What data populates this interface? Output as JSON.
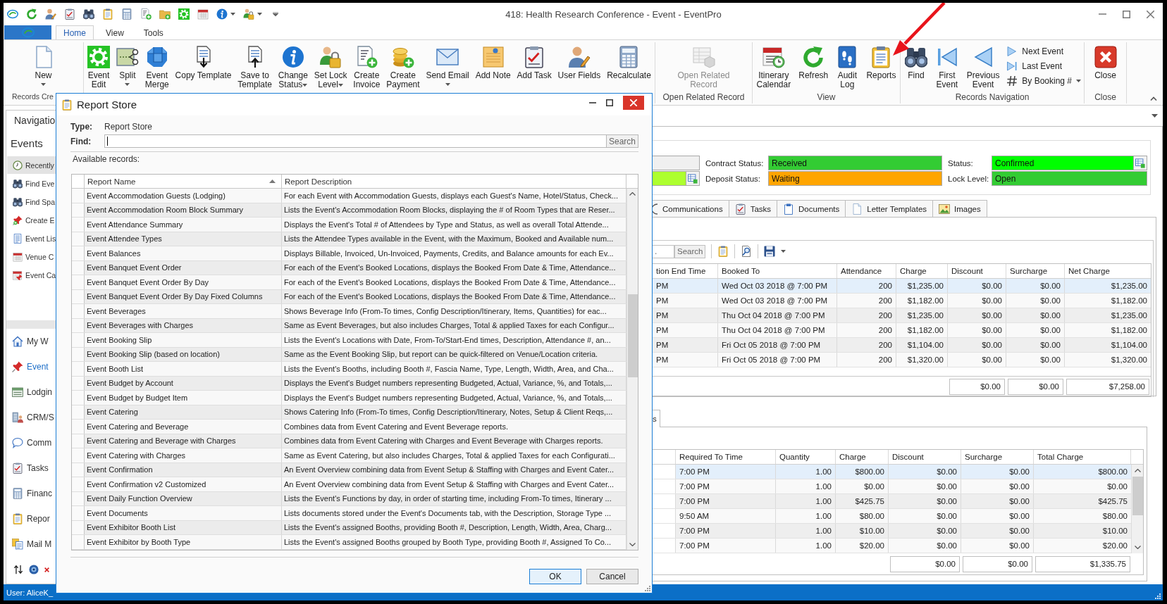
{
  "window": {
    "title": "418: Health Research Conference - Event - EventPro"
  },
  "ribbon": {
    "tabs": [
      {
        "label": "Home",
        "selected": true
      },
      {
        "label": "View",
        "selected": false
      },
      {
        "label": "Tools",
        "selected": false
      }
    ],
    "groups": [
      {
        "label": "Records Cre",
        "buttons": [
          {
            "label": "New",
            "kind": "large",
            "dropdown": true,
            "disabled": false
          }
        ]
      },
      {
        "buttons": [
          {
            "label": "Event\nEdit",
            "kind": "large",
            "dropdown": false,
            "disabled": false
          },
          {
            "label": "Split",
            "kind": "large",
            "dropdown": true,
            "disabled": false
          },
          {
            "label": "Event\nMerge",
            "kind": "large",
            "dropdown": false,
            "disabled": false
          },
          {
            "label": "Copy Template",
            "kind": "large",
            "dropdown": false,
            "disabled": false
          },
          {
            "label": "Save to\nTemplate",
            "kind": "large",
            "dropdown": false,
            "disabled": false
          },
          {
            "label": "Change\nStatus",
            "kind": "large",
            "dropdown": true,
            "disabled": false
          },
          {
            "label": "Set Lock\nLevel",
            "kind": "large",
            "dropdown": true,
            "disabled": false
          },
          {
            "label": "Create\nInvoice",
            "kind": "large",
            "dropdown": false,
            "disabled": false
          },
          {
            "label": "Create\nPayment",
            "kind": "large",
            "dropdown": false,
            "disabled": false
          },
          {
            "label": "Send Email",
            "kind": "large",
            "dropdown": true,
            "disabled": false
          },
          {
            "label": "Add Note",
            "kind": "large",
            "dropdown": false,
            "disabled": false
          },
          {
            "label": "Add Task",
            "kind": "large",
            "dropdown": false,
            "disabled": false
          },
          {
            "label": "User Fields",
            "kind": "large",
            "dropdown": false,
            "disabled": false
          },
          {
            "label": "Recalculate",
            "kind": "large",
            "dropdown": false,
            "disabled": false
          }
        ]
      },
      {
        "label": "Open Related Record",
        "buttons": [
          {
            "label": "Open Related\nRecord",
            "kind": "large",
            "dropdown": false,
            "disabled": true
          }
        ]
      },
      {
        "label": "View",
        "buttons": [
          {
            "label": "Itinerary\nCalendar",
            "kind": "large",
            "dropdown": false,
            "disabled": false
          },
          {
            "label": "Refresh",
            "kind": "large",
            "dropdown": false,
            "disabled": false
          },
          {
            "label": "Audit\nLog",
            "kind": "large",
            "dropdown": false,
            "disabled": false
          },
          {
            "label": "Reports",
            "kind": "large",
            "dropdown": false,
            "disabled": false
          }
        ]
      },
      {
        "label": "Records Navigation",
        "buttons": [
          {
            "label": "Find",
            "kind": "large",
            "dropdown": false,
            "disabled": false
          },
          {
            "label": "First\nEvent",
            "kind": "large",
            "dropdown": false,
            "disabled": false
          },
          {
            "label": "Previous\nEvent",
            "kind": "large",
            "dropdown": false,
            "disabled": false
          },
          {
            "label": "Next Event",
            "kind": "small",
            "dropdown": false,
            "disabled": false
          },
          {
            "label": "Last Event",
            "kind": "small",
            "dropdown": false,
            "disabled": false
          },
          {
            "label": "By Booking #",
            "kind": "small",
            "dropdown": true,
            "disabled": false
          }
        ]
      },
      {
        "label": "Close",
        "buttons": [
          {
            "label": "Close",
            "kind": "large",
            "dropdown": false,
            "disabled": false
          }
        ]
      }
    ]
  },
  "navigation": {
    "title": "Navigatio",
    "section": "Events",
    "items": [
      {
        "label": "Recently",
        "selected": true
      },
      {
        "label": "Find Eve",
        "selected": false
      },
      {
        "label": "Find Spa",
        "selected": false
      },
      {
        "label": "Create E",
        "selected": false
      },
      {
        "label": "Event Lis",
        "selected": false
      },
      {
        "label": "Venue C",
        "selected": false
      },
      {
        "label": "Event Ca",
        "selected": false
      }
    ],
    "modules": [
      {
        "label": "My W",
        "selected": false
      },
      {
        "label": "Event",
        "selected": true
      },
      {
        "label": "Lodgin",
        "selected": false
      },
      {
        "label": "CRM/S",
        "selected": false
      },
      {
        "label": "Comm",
        "selected": false
      },
      {
        "label": "Tasks",
        "selected": false
      },
      {
        "label": "Financ",
        "selected": false
      },
      {
        "label": "Repor",
        "selected": false
      },
      {
        "label": "Mail M",
        "selected": false
      }
    ]
  },
  "dialog": {
    "title": "Report Store",
    "type_label": "Type:",
    "type_value": "Report Store",
    "find": {
      "label": "Find:",
      "focused": true
    },
    "search_button": "Search",
    "list_label": "Available records:",
    "columns": [
      {
        "label": "Report Name",
        "sorted": true
      },
      {
        "label": "Report Description",
        "sorted": false
      }
    ],
    "rows": [
      {
        "name": "Event Accommodation Guests (Lodging)",
        "description": "For each Event with Accommodation Guests, displays each Guest's Name, Hotel/Status, Check..."
      },
      {
        "name": "Event Accommodation Room Block Summary",
        "description": "Lists the Event's Accommodation Room Blocks, displaying the # of Room Types that are Reser..."
      },
      {
        "name": "Event Attendance Summary",
        "description": "Displays the Event's Total # of Attendees by Type and Status, as well as overall Total Attende..."
      },
      {
        "name": "Event Attendee Types",
        "description": "Lists the Attendee Types available in the Event, with the Maximum, Booked and Available num..."
      },
      {
        "name": "Event Balances",
        "description": "Displays Billable, Invoiced, Un-Invoiced, Payments, Credits, and Balance amounts for each Ev..."
      },
      {
        "name": "Event Banquet Event Order",
        "description": "For each of the Event's Booked Locations, displays the Booked From Date & Time, Attendance..."
      },
      {
        "name": "Event Banquet Event Order By Day",
        "description": "For each of the Event's Booked Locations, displays the Booked From Date & Time, Attendance..."
      },
      {
        "name": "Event Banquet Event Order By Day Fixed Columns",
        "description": "For each of the Event's Booked Locations, displays the Booked From Date & Time, Attendance..."
      },
      {
        "name": "Event Beverages",
        "description": "Shows Beverage Info (From-To times, Config Description/Itinerary, Items, Quantities) for eac..."
      },
      {
        "name": "Event Beverages with Charges",
        "description": "Same as Event Beverages, but also includes Charges, Total & applied Taxes for each Configur..."
      },
      {
        "name": "Event Booking Slip",
        "description": "Lists the Event's Locations with Date, From-To/Start-End times, Description, Attendance #, an..."
      },
      {
        "name": "Event Booking Slip (based on location)",
        "description": "Same as the Event Booking Slip, but report can be quick-filtered on Venue/Location criteria."
      },
      {
        "name": "Event Booth List",
        "description": "Lists the Event's Booths, including Booth #, Fascia Name, Type, Length, Width, Area, and Cha..."
      },
      {
        "name": "Event Budget by Account",
        "description": "Displays the Event's Budget numbers representing Budgeted, Actual, Variance, %, and Totals,..."
      },
      {
        "name": "Event Budget by Budget Item",
        "description": "Displays the Event's Budget numbers representing Budgeted, Actual, Variance, %, and Totals,..."
      },
      {
        "name": "Event Catering",
        "description": "Shows Catering Info (From-To times, Config Description/Itinerary, Notes, Setup & Client Reqs,..."
      },
      {
        "name": "Event Catering and Beverage",
        "description": "Combines data from Event Catering and Event Beverage reports."
      },
      {
        "name": "Event Catering and Beverage with Charges",
        "description": "Combines data from Event Catering with Charges and Event Beverage with Charges reports."
      },
      {
        "name": "Event Catering with Charges",
        "description": "Same as Event Catering, but also includes Charges, Total & applied Taxes for each Configurati..."
      },
      {
        "name": "Event Confirmation",
        "description": "An Event Overview combining data from Event Setup & Staffing with Charges and Event Cater..."
      },
      {
        "name": "Event Confirmation v2 Customized",
        "description": "An Event Overview combining data from Event Setup & Staffing with Charges and Event Cater..."
      },
      {
        "name": "Event Daily Function Overview",
        "description": "Lists the Event's Functions by day, in order of starting time, including From-To times, Itinerary ..."
      },
      {
        "name": "Event Documents",
        "description": "Lists documents stored under the Event's Documents tab, with the Description, Storage Type ..."
      },
      {
        "name": "Event Exhibitor Booth List",
        "description": "Lists the Event's assigned Booths, providing Booth #, Description, Length, Width, Area, Charg..."
      },
      {
        "name": "Event Exhibitor by Booth Type",
        "description": "Lists the Event's assigned Booths grouped by Booth Type, providing Booth #, Assigned To Co..."
      }
    ],
    "buttons": [
      {
        "label": "OK",
        "default": true
      },
      {
        "label": "Cancel",
        "default": false
      }
    ]
  },
  "record": {
    "field_rows": [
      {
        "cut_field": {
          "color": "#f0f0f0",
          "lookup": false
        },
        "fields": [
          {
            "label": "Contract Status:",
            "value": "Received",
            "color": "#33cc33",
            "lookup": false
          },
          {
            "label": "Status:",
            "value": "Confirmed",
            "color": "#00ff00",
            "lookup": true
          }
        ]
      },
      {
        "cut_field": {
          "color": "#adff2f",
          "lookup": true
        },
        "fields": [
          {
            "label": "Deposit Status:",
            "value": "Waiting",
            "color": "#ffa500",
            "lookup": false
          },
          {
            "label": "Lock Level:",
            "value": "Open",
            "color": "#33cc33",
            "lookup": false
          }
        ]
      }
    ],
    "tabs": [
      {
        "label": "Communications",
        "selected": false
      },
      {
        "label": "Tasks",
        "selected": false
      },
      {
        "label": "Documents",
        "selected": false
      },
      {
        "label": "Letter Templates",
        "selected": false
      },
      {
        "label": "Images",
        "selected": false
      }
    ]
  },
  "bookings": {
    "search_field": {
      "placeholder": "."
    },
    "search_button": "Search",
    "columns": [
      "tion End Time",
      "Booked To",
      "Attendance",
      "Charge",
      "Discount",
      "Surcharge",
      "Net Charge"
    ],
    "rows": [
      {
        "cells": [
          "PM",
          "Wed Oct 03 2018 @ 7:00 PM",
          "200",
          "$1,235.00",
          "$0.00",
          "$0.00",
          "$1,235.00"
        ],
        "selected": true
      },
      {
        "cells": [
          "PM",
          "Wed Oct 03 2018 @ 7:00 PM",
          "200",
          "$1,182.00",
          "$0.00",
          "$0.00",
          "$1,182.00"
        ],
        "selected": false
      },
      {
        "cells": [
          "PM",
          "Thu Oct 04 2018 @ 7:00 PM",
          "200",
          "$1,235.00",
          "$0.00",
          "$0.00",
          "$1,235.00"
        ],
        "selected": false
      },
      {
        "cells": [
          "PM",
          "Thu Oct 04 2018 @ 7:00 PM",
          "200",
          "$1,182.00",
          "$0.00",
          "$0.00",
          "$1,182.00"
        ],
        "selected": false
      },
      {
        "cells": [
          "PM",
          "Fri Oct 05 2018 @ 7:00 PM",
          "200",
          "$1,104.00",
          "$0.00",
          "$0.00",
          "$1,104.00"
        ],
        "selected": false
      },
      {
        "cells": [
          "PM",
          "Fri Oct 05 2018 @ 7:00 PM",
          "200",
          "$1,320.00",
          "$0.00",
          "$0.00",
          "$1,320.00"
        ],
        "selected": false
      }
    ],
    "totals": [
      "$0.00",
      "$0.00",
      "$7,258.00"
    ]
  },
  "lower": {
    "tabs": [
      {
        "label": "s",
        "selected": true
      }
    ],
    "columns": [
      "Required To Time",
      "Quantity",
      "Charge",
      "Discount",
      "Surcharge",
      "Total Charge"
    ],
    "rows": [
      {
        "cells": [
          "7:00 PM",
          "1.00",
          "$800.00",
          "$0.00",
          "$0.00",
          "$800.00"
        ],
        "selected": true
      },
      {
        "cells": [
          "7:00 PM",
          "1.00",
          "$0.00",
          "$0.00",
          "$0.00",
          "$0.00"
        ],
        "selected": false
      },
      {
        "cells": [
          "7:00 PM",
          "1.00",
          "$425.75",
          "$0.00",
          "$0.00",
          "$425.75"
        ],
        "selected": false
      },
      {
        "cells": [
          "9:50 AM",
          "1.00",
          "$80.00",
          "$0.00",
          "$0.00",
          "$80.00"
        ],
        "selected": false
      },
      {
        "cells": [
          "7:00 PM",
          "1.00",
          "$10.00",
          "$0.00",
          "$0.00",
          "$10.00"
        ],
        "selected": false
      },
      {
        "cells": [
          "7:00 PM",
          "1.00",
          "$20.00",
          "$0.00",
          "$0.00",
          "$20.00"
        ],
        "selected": false
      }
    ],
    "totals": [
      "$0.00",
      "$0.00",
      "$1,335.75"
    ]
  },
  "status_bar": {
    "user": "User: AliceK_"
  }
}
